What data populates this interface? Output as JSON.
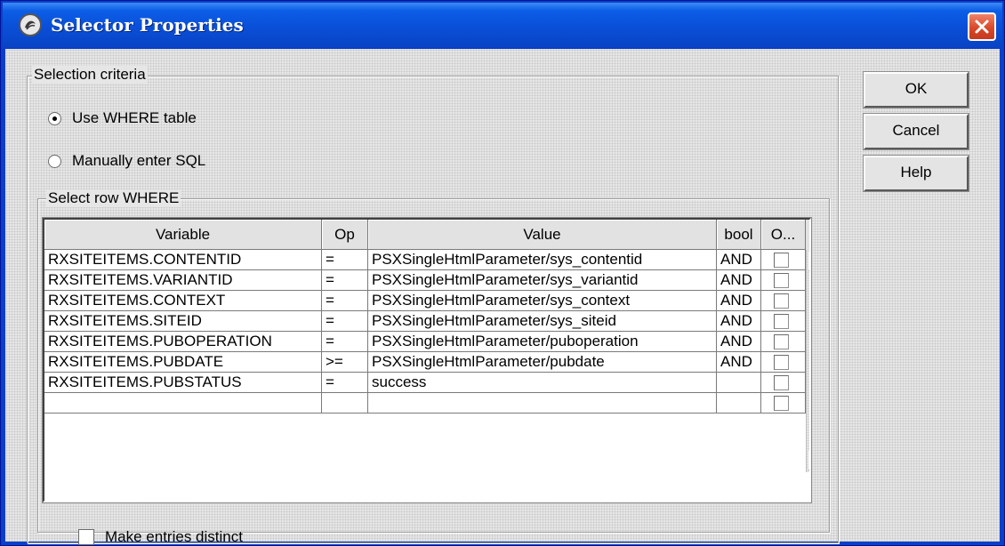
{
  "window": {
    "title": "Selector Properties"
  },
  "selection_criteria": {
    "legend": "Selection criteria",
    "options": [
      {
        "label": "Use WHERE table",
        "selected": true
      },
      {
        "label": "Manually enter SQL",
        "selected": false
      }
    ]
  },
  "where_group": {
    "legend": "Select row WHERE",
    "columns": [
      "Variable",
      "Op",
      "Value",
      "bool",
      "O..."
    ],
    "rows": [
      {
        "variable": "RXSITEITEMS.CONTENTID",
        "op": "=",
        "value": "PSXSingleHtmlParameter/sys_contentid",
        "bool": "AND",
        "checked": false
      },
      {
        "variable": "RXSITEITEMS.VARIANTID",
        "op": "=",
        "value": "PSXSingleHtmlParameter/sys_variantid",
        "bool": "AND",
        "checked": false
      },
      {
        "variable": "RXSITEITEMS.CONTEXT",
        "op": "=",
        "value": "PSXSingleHtmlParameter/sys_context",
        "bool": "AND",
        "checked": false
      },
      {
        "variable": "RXSITEITEMS.SITEID",
        "op": "=",
        "value": "PSXSingleHtmlParameter/sys_siteid",
        "bool": "AND",
        "checked": false
      },
      {
        "variable": "RXSITEITEMS.PUBOPERATION",
        "op": "=",
        "value": "PSXSingleHtmlParameter/puboperation",
        "bool": "AND",
        "checked": false
      },
      {
        "variable": "RXSITEITEMS.PUBDATE",
        "op": ">=",
        "value": "PSXSingleHtmlParameter/pubdate",
        "bool": "AND",
        "checked": false
      },
      {
        "variable": "RXSITEITEMS.PUBSTATUS",
        "op": "=",
        "value": "success",
        "bool": "",
        "checked": false
      },
      {
        "variable": "",
        "op": "",
        "value": "",
        "bool": "",
        "checked": false
      }
    ],
    "distinct_label": "Make entries distinct",
    "distinct_checked": false
  },
  "buttons": {
    "ok": "OK",
    "cancel": "Cancel",
    "help": "Help"
  },
  "icons": {
    "window_icon": "app-logo-icon",
    "close": "close-icon",
    "scroll_up": "arrow-up-icon",
    "scroll_down": "arrow-down-icon"
  },
  "colors": {
    "titlebar": "#0a4fd8",
    "close_button": "#d9482a",
    "dialog_bg": "#e6e6e6"
  }
}
